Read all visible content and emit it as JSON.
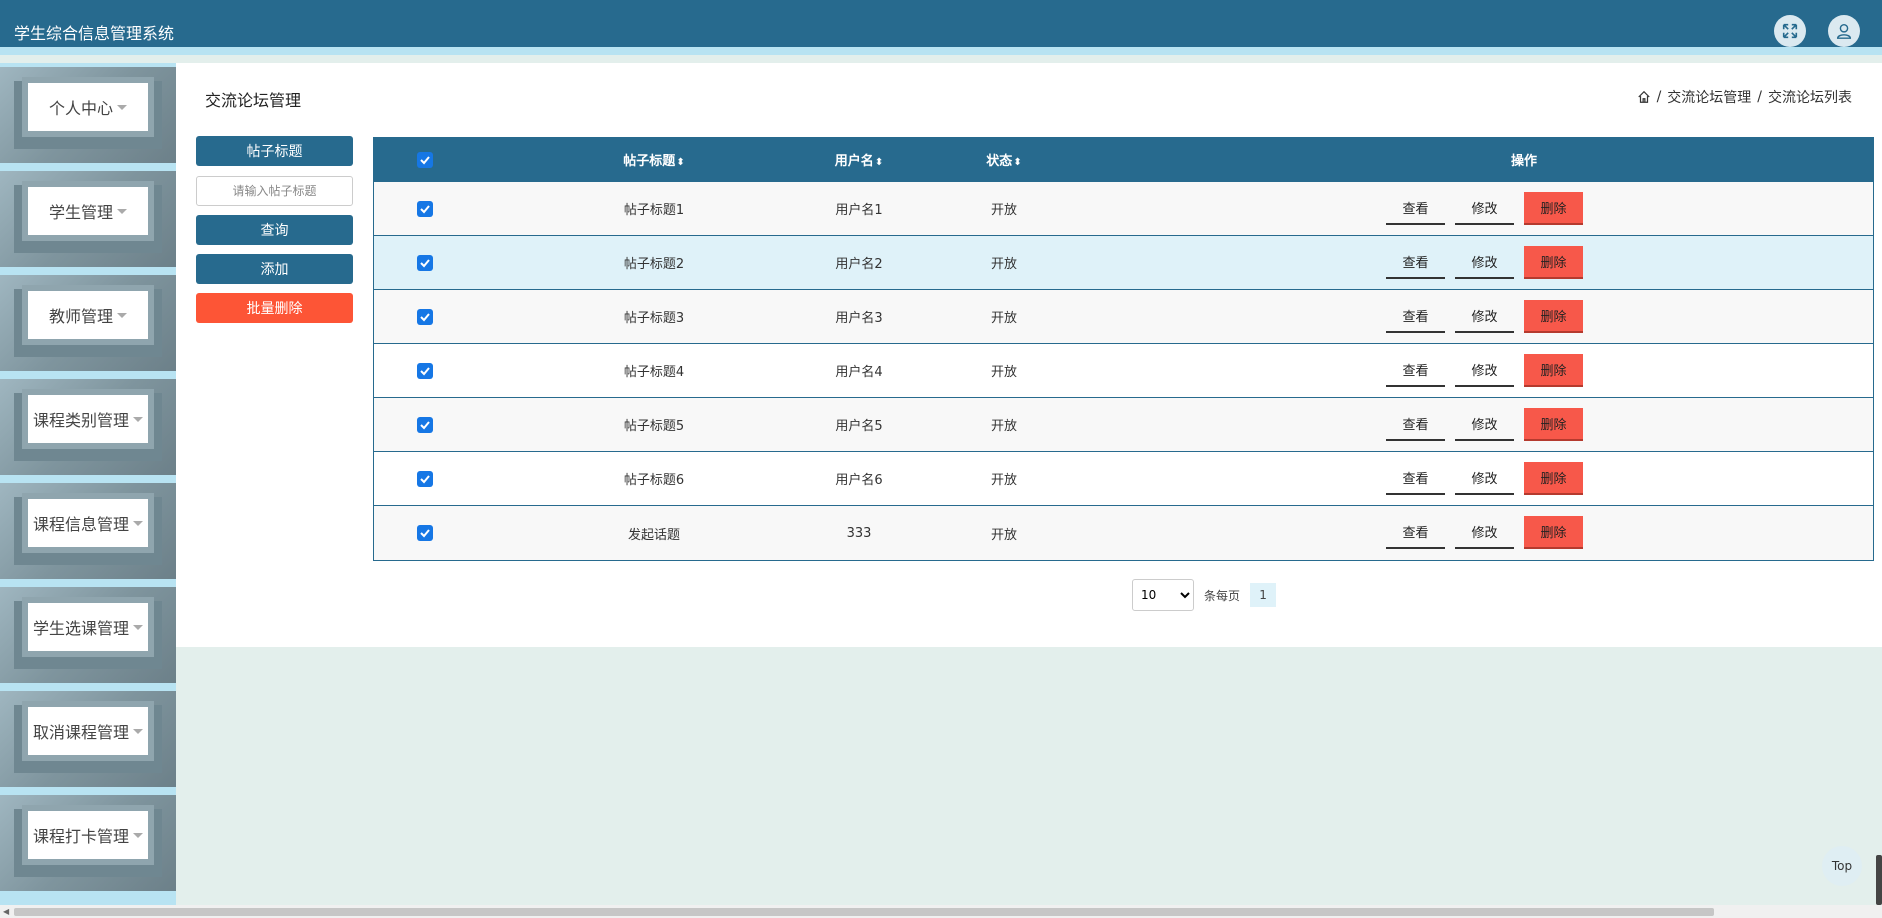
{
  "app": {
    "title": "学生综合信息管理系统"
  },
  "sidebar": {
    "items": [
      {
        "label": "个人中心"
      },
      {
        "label": "学生管理"
      },
      {
        "label": "教师管理"
      },
      {
        "label": "课程类别管理"
      },
      {
        "label": "课程信息管理"
      },
      {
        "label": "学生选课管理"
      },
      {
        "label": "取消课程管理"
      },
      {
        "label": "课程打卡管理"
      }
    ]
  },
  "main": {
    "page_title": "交流论坛管理",
    "breadcrumb": [
      "交流论坛管理",
      "交流论坛列表"
    ],
    "breadcrumb_sep": "/"
  },
  "search": {
    "field_label": "帖子标题",
    "placeholder": "请输入帖子标题",
    "query_button": "查询",
    "add_button": "添加",
    "batch_delete_button": "批量删除"
  },
  "table": {
    "columns": {
      "title": "帖子标题",
      "user": "用户名",
      "status": "状态",
      "ops": "操作"
    },
    "sort_glyph": "⬍",
    "actions": {
      "view": "查看",
      "edit": "修改",
      "delete": "删除"
    },
    "rows": [
      {
        "title": "帖子标题1",
        "user": "用户名1",
        "status": "开放"
      },
      {
        "title": "帖子标题2",
        "user": "用户名2",
        "status": "开放"
      },
      {
        "title": "帖子标题3",
        "user": "用户名3",
        "status": "开放"
      },
      {
        "title": "帖子标题4",
        "user": "用户名4",
        "status": "开放"
      },
      {
        "title": "帖子标题5",
        "user": "用户名5",
        "status": "开放"
      },
      {
        "title": "帖子标题6",
        "user": "用户名6",
        "status": "开放"
      },
      {
        "title": "发起话题",
        "user": "333",
        "status": "开放"
      }
    ]
  },
  "pagination": {
    "page_size": "10",
    "per_page_label": "条每页",
    "current_page": "1"
  },
  "top_button": "Top",
  "colors": {
    "primary": "#276a8e",
    "danger": "#fd5536",
    "accent_light": "#b8e3f2",
    "checkbox": "#1677e5"
  }
}
